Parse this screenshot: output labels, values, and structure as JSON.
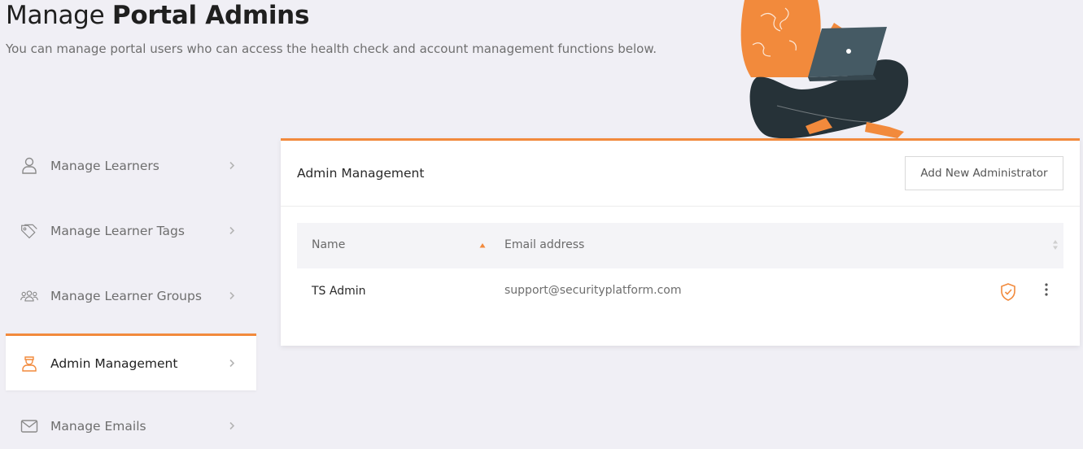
{
  "page": {
    "title_normal": "Manage ",
    "title_bold": "Portal Admins",
    "subtitle": "You can manage portal users who can access the health check and account management functions below."
  },
  "sidebar": {
    "items": [
      {
        "label": "Manage Learners",
        "icon": "user-icon"
      },
      {
        "label": "Manage Learner Tags",
        "icon": "tag-icon"
      },
      {
        "label": "Manage Learner Groups",
        "icon": "group-icon"
      },
      {
        "label": "Admin Management",
        "icon": "admin-icon",
        "active": true
      },
      {
        "label": "Manage Emails",
        "icon": "mail-icon"
      }
    ]
  },
  "panel": {
    "title": "Admin Management",
    "add_button_label": "Add New Administrator",
    "table": {
      "columns": [
        "Name",
        "Email address"
      ],
      "rows": [
        {
          "name": "TS Admin",
          "email": "support@securityplatform.com",
          "status_icon": "shield-check-icon",
          "menu_icon": "kebab-menu-icon"
        }
      ]
    }
  },
  "colors": {
    "accent": "#f28a3c",
    "background": "#f0eff5",
    "illustration_dark": "#263238"
  }
}
